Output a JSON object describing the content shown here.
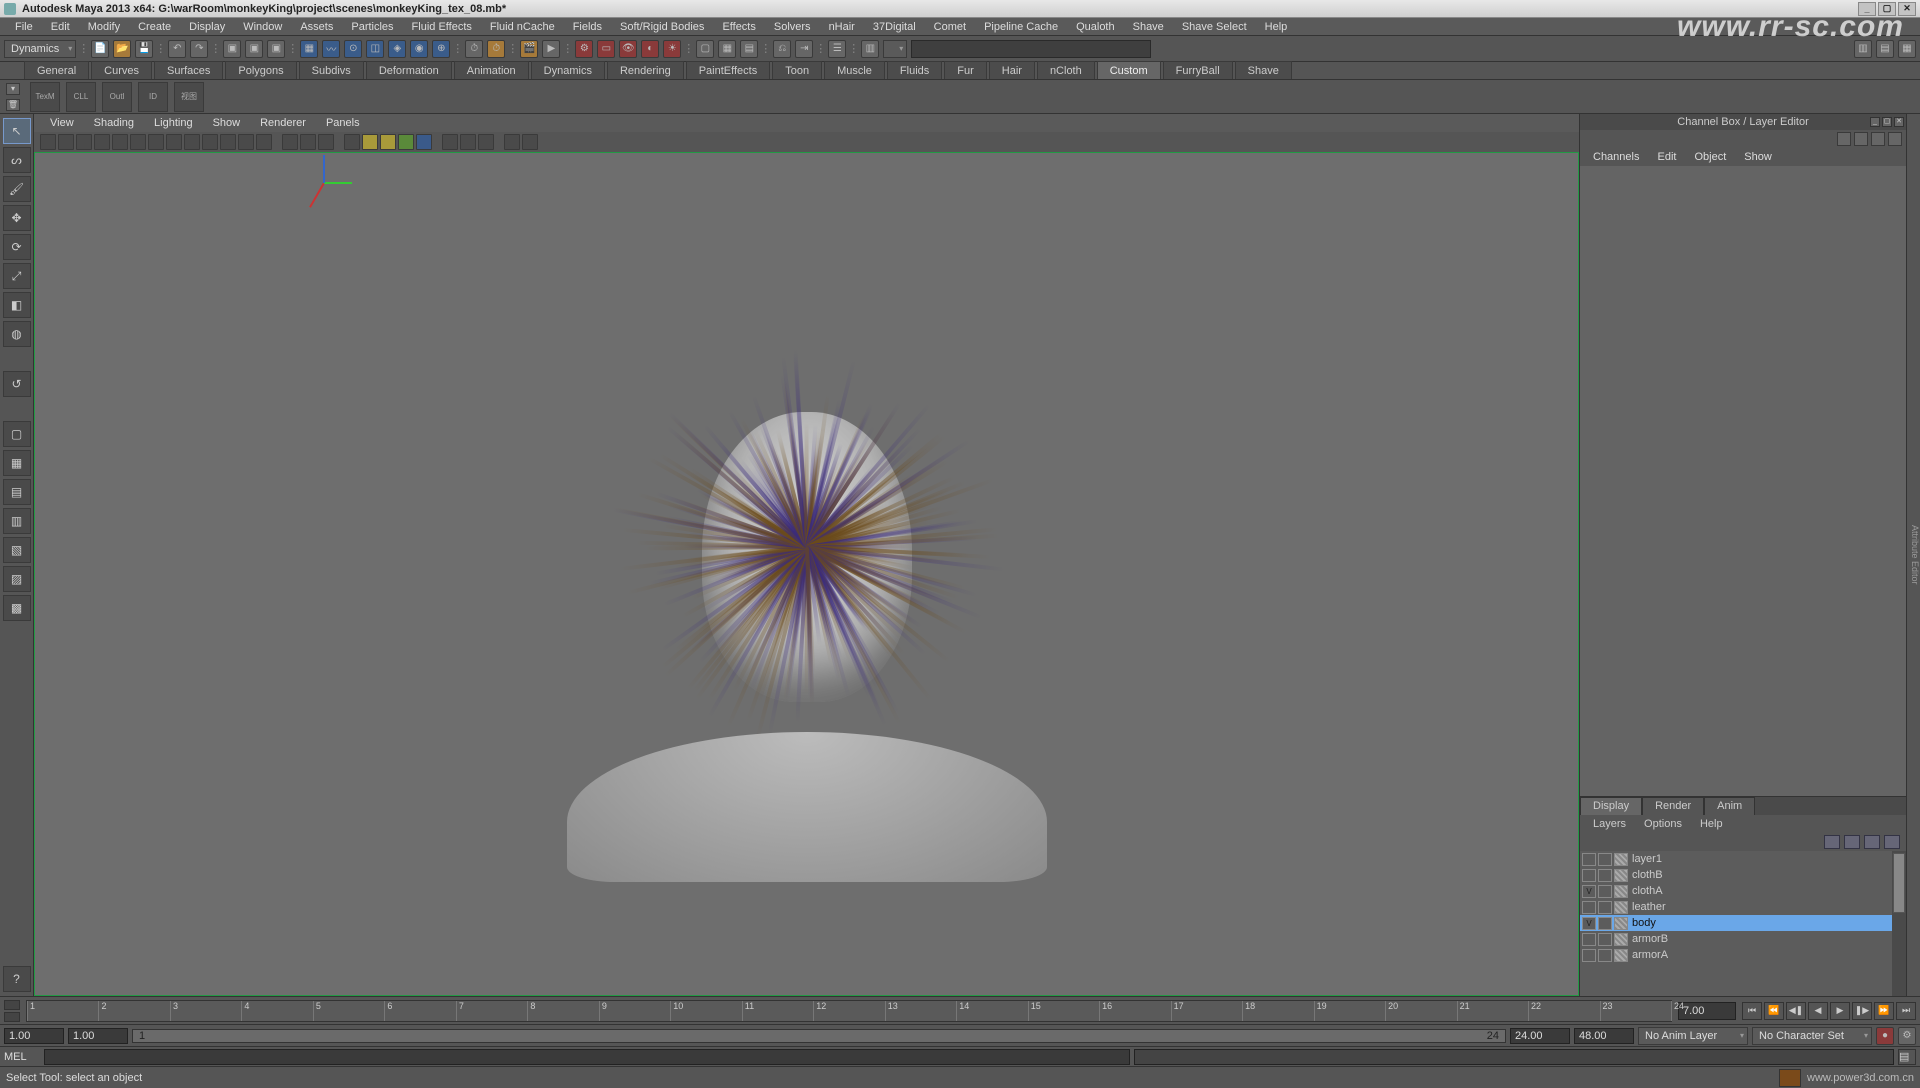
{
  "window": {
    "title": "Autodesk Maya 2013 x64: G:\\warRoom\\monkeyKing\\project\\scenes\\monkeyKing_tex_08.mb*"
  },
  "menubar": [
    "File",
    "Edit",
    "Modify",
    "Create",
    "Display",
    "Window",
    "Assets",
    "Particles",
    "Fluid Effects",
    "Fluid nCache",
    "Fields",
    "Soft/Rigid Bodies",
    "Effects",
    "Solvers",
    "nHair",
    "37Digital",
    "Comet",
    "Pipeline Cache",
    "Qualoth",
    "Shave",
    "Shave Select",
    "Help"
  ],
  "statusline": {
    "mode": "Dynamics",
    "search_placeholder": ""
  },
  "shelf_tabs": [
    "General",
    "Curves",
    "Surfaces",
    "Polygons",
    "Subdivs",
    "Deformation",
    "Animation",
    "Dynamics",
    "Rendering",
    "PaintEffects",
    "Toon",
    "Muscle",
    "Fluids",
    "Fur",
    "Hair",
    "nCloth",
    "Custom",
    "FurryBall",
    "Shave"
  ],
  "shelf_active": "Custom",
  "shelf_buttons": [
    "TexM",
    "CLL",
    "Outl",
    "ID",
    "视图"
  ],
  "panel_menus": [
    "View",
    "Shading",
    "Lighting",
    "Show",
    "Renderer",
    "Panels"
  ],
  "channelbox": {
    "title": "Channel Box / Layer Editor",
    "menus": [
      "Channels",
      "Edit",
      "Object",
      "Show"
    ]
  },
  "layereditor": {
    "tabs": [
      "Display",
      "Render",
      "Anim"
    ],
    "active_tab": "Display",
    "menus": [
      "Layers",
      "Options",
      "Help"
    ],
    "layers": [
      {
        "vis": "",
        "name": "layer1",
        "sel": false
      },
      {
        "vis": "",
        "name": "clothB",
        "sel": false
      },
      {
        "vis": "V",
        "name": "clothA",
        "sel": false
      },
      {
        "vis": "",
        "name": "leather",
        "sel": false
      },
      {
        "vis": "V",
        "name": "body",
        "sel": true
      },
      {
        "vis": "",
        "name": "armorB",
        "sel": false
      },
      {
        "vis": "",
        "name": "armorA",
        "sel": false
      }
    ]
  },
  "time": {
    "ticks": [
      1,
      2,
      3,
      4,
      5,
      6,
      7,
      8,
      9,
      10,
      11,
      12,
      13,
      14,
      15,
      16,
      17,
      18,
      19,
      20,
      21,
      22,
      23,
      24
    ],
    "current": "7.00",
    "range_start_outer": "1.00",
    "range_start_inner": "1.00",
    "range_end_inner": "24.00",
    "range_end_outer": "48.00",
    "bar_start": "1",
    "bar_end": "24",
    "anim_layer": "No Anim Layer",
    "char_set": "No Character Set"
  },
  "cmd": {
    "lang": "MEL"
  },
  "help": {
    "text": "Select Tool: select an object"
  },
  "footer": {
    "url": "www.power3d.com.cn"
  },
  "watermark": "www.rr-sc.com"
}
